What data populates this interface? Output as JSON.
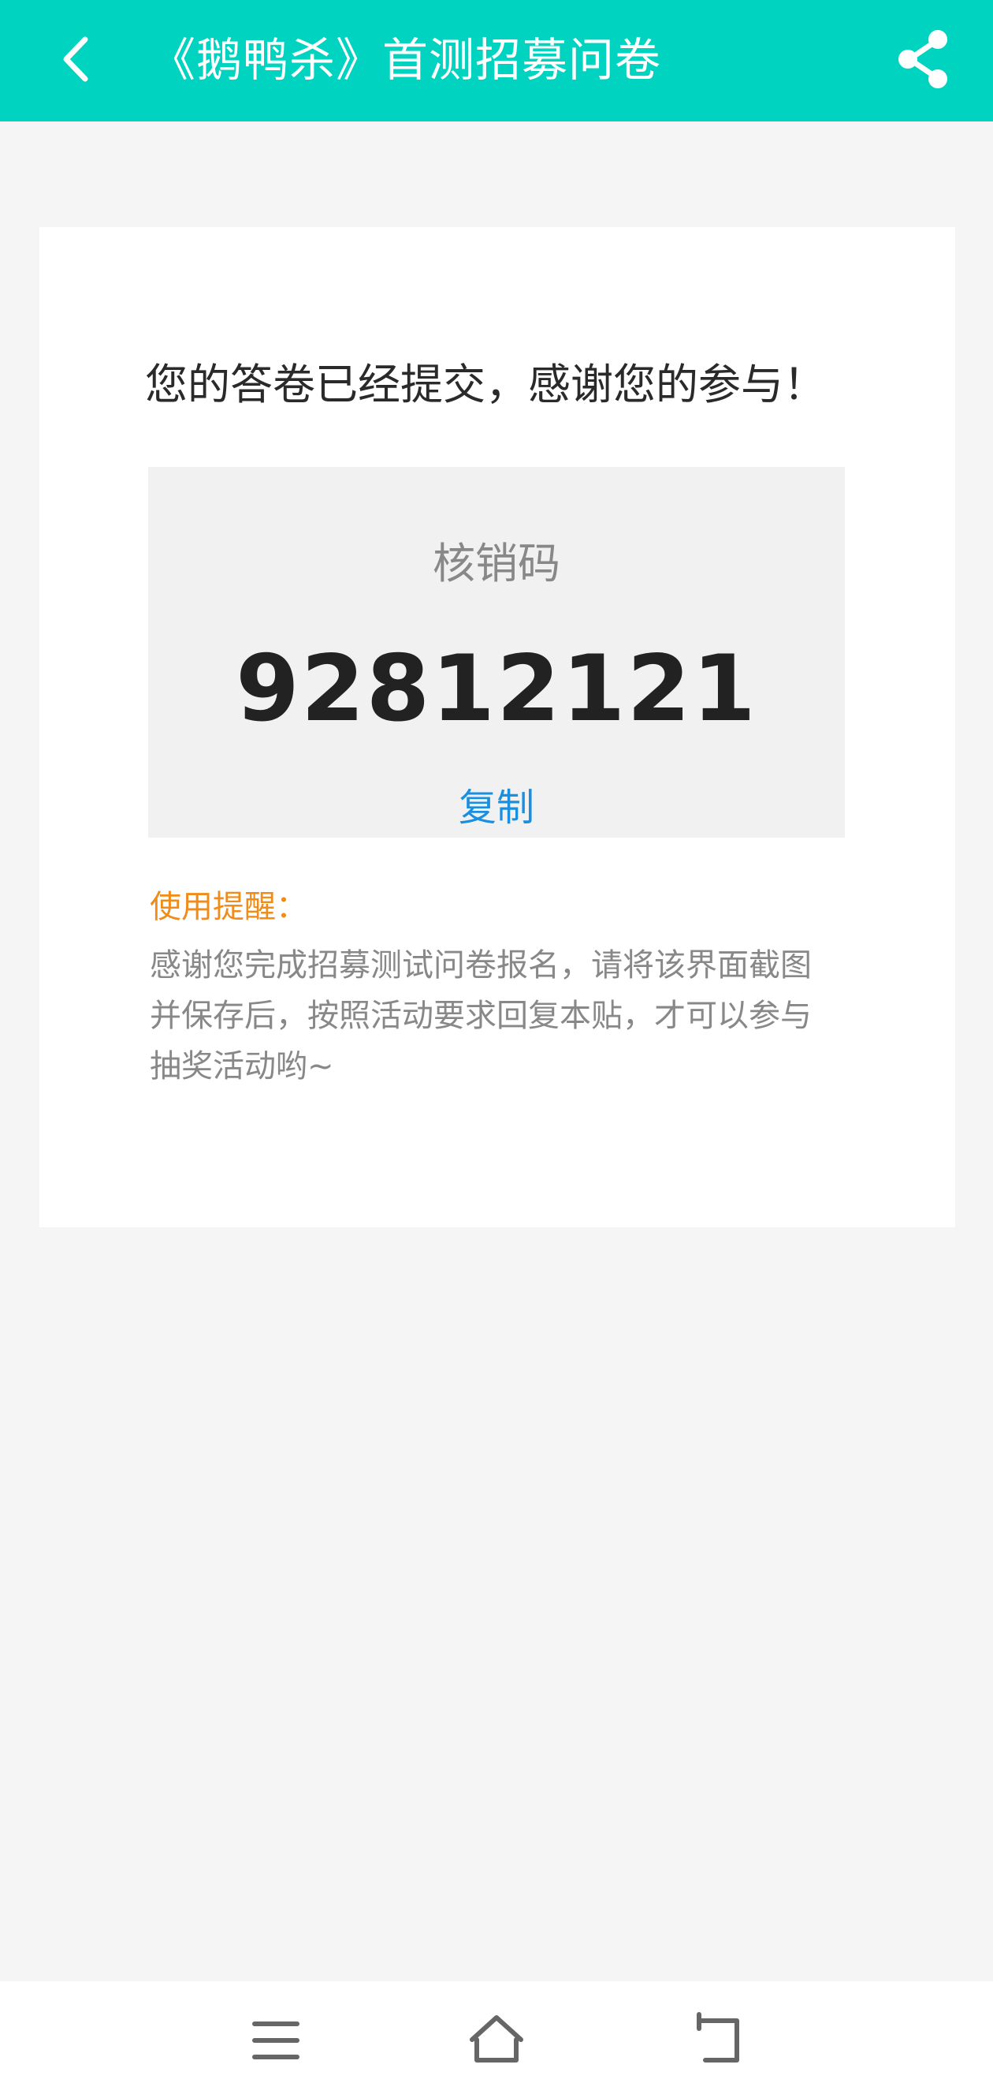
{
  "header": {
    "title": "《鹅鸭杀》首测招募问卷",
    "back_icon": "chevron-left-icon",
    "share_icon": "share-icon",
    "background_color": "#00d3c0"
  },
  "card": {
    "message": "您的答卷已经提交，感谢您的参与！",
    "code_label": "核销码",
    "code_value": "92812121",
    "copy_label": "复制",
    "reminder_title": "使用提醒：",
    "reminder_lines": [
      "感谢您完成招募测试问卷报名，请将该界面截图",
      "并保存后，按照活动要求回复本贴，才可以参与",
      "抽奖活动哟~"
    ],
    "colors": {
      "copy": "#1a8fe0",
      "reminder_title": "#f08d1a"
    }
  },
  "nav_bar": {
    "icons": [
      "menu-icon",
      "home-icon",
      "back-icon"
    ]
  }
}
